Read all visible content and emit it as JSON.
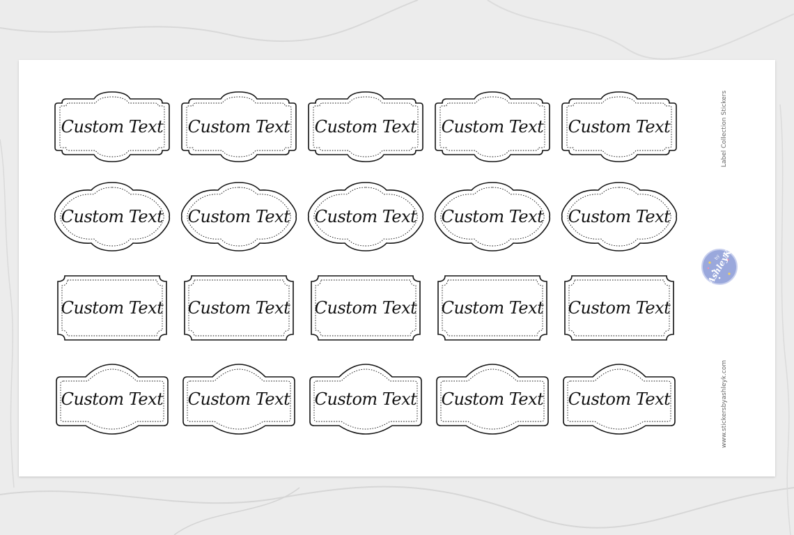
{
  "sheet": {
    "title": "Label Collection Stickers",
    "website": "www.stickersbyashleyk.com"
  },
  "logo": {
    "by": "by",
    "name": "AshleyK",
    "color": "#9aa8dc"
  },
  "rows": [
    {
      "shape": "arched-tab",
      "labels": [
        "Custom Text",
        "Custom Text",
        "Custom Text",
        "Custom Text",
        "Custom Text"
      ]
    },
    {
      "shape": "scalloped-oval",
      "labels": [
        "Custom Text",
        "Custom Text",
        "Custom Text",
        "Custom Text",
        "Custom Text"
      ]
    },
    {
      "shape": "notched-rectangle",
      "labels": [
        "Custom Text",
        "Custom Text",
        "Custom Text",
        "Custom Text",
        "Custom Text"
      ]
    },
    {
      "shape": "dome-rectangle",
      "labels": [
        "Custom Text",
        "Custom Text",
        "Custom Text",
        "Custom Text",
        "Custom Text"
      ]
    }
  ],
  "colors": {
    "sheet": "#ffffff",
    "outline": "#111111",
    "background": "#ececec"
  }
}
